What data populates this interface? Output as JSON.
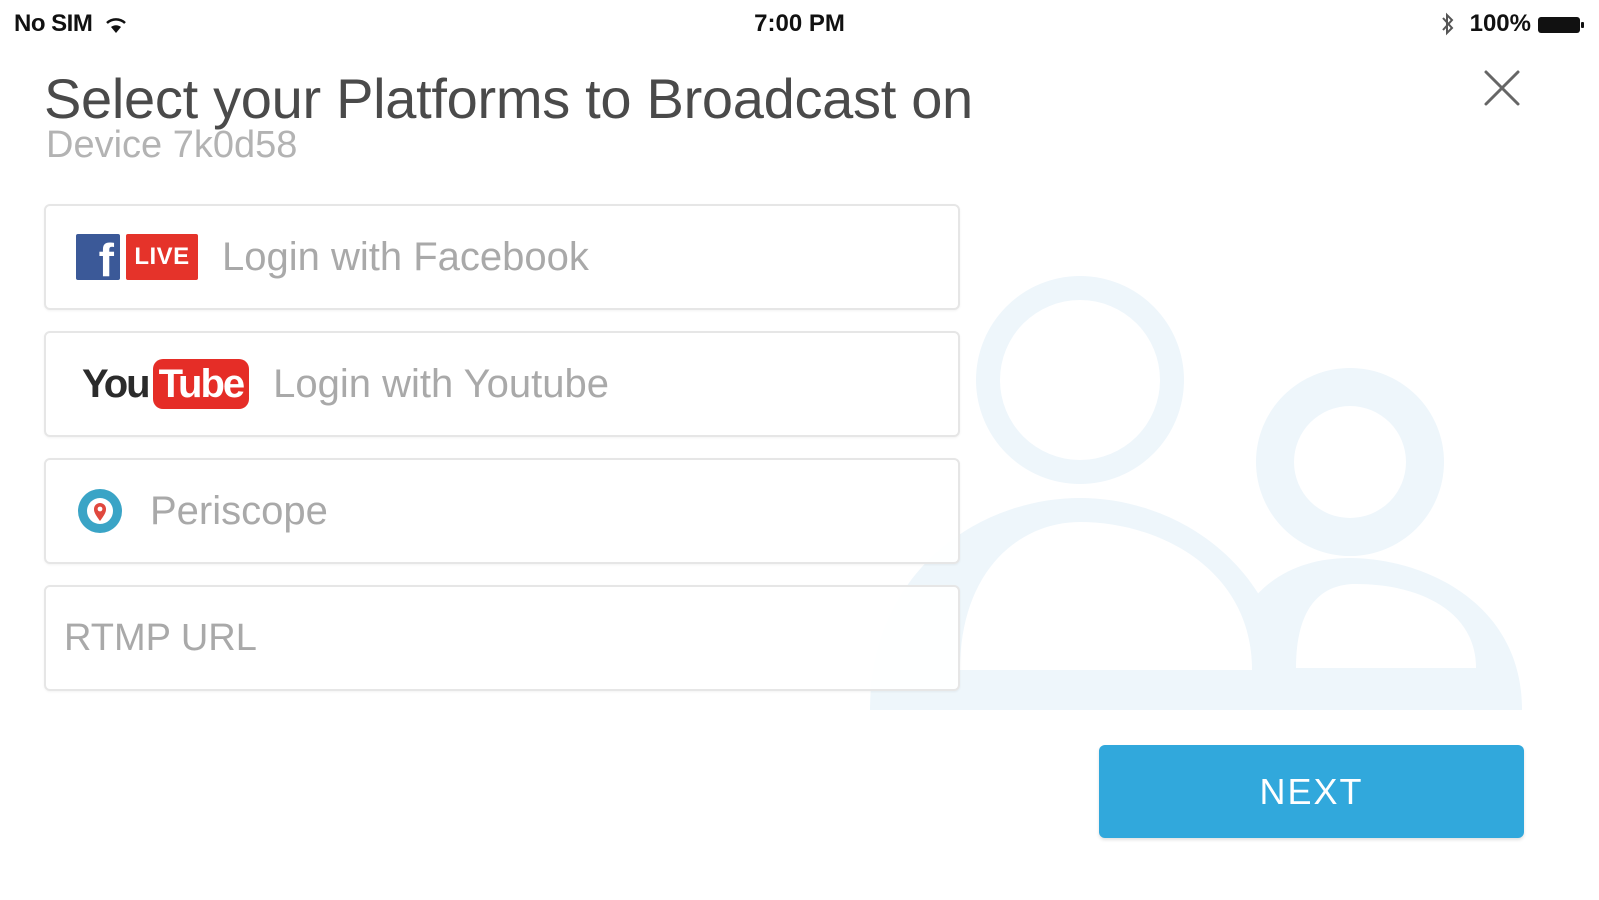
{
  "status_bar": {
    "carrier": "No SIM",
    "time": "7:00 PM",
    "battery": "100%",
    "icons": [
      "wifi-icon",
      "bluetooth-icon",
      "battery-icon"
    ]
  },
  "header": {
    "title": "Select your Platforms to Broadcast on",
    "subtitle": "Device 7k0d58",
    "close_icon": "close-icon"
  },
  "platforms": {
    "facebook": {
      "badge": "LIVE",
      "logo_letter": "f",
      "label": "Login with Facebook"
    },
    "youtube": {
      "logo_you": "You",
      "logo_tube": "Tube",
      "label": "Login with Youtube"
    },
    "periscope": {
      "label": "Periscope"
    },
    "rtmp": {
      "placeholder": "RTMP URL",
      "value": ""
    }
  },
  "footer": {
    "next_label": "NEXT"
  },
  "colors": {
    "accent": "#31a8dc",
    "facebook_blue": "#3b5998",
    "facebook_live_red": "#e5332a",
    "youtube_red": "#e52d27",
    "periscope_teal": "#3aa4c6",
    "illustration": "#eef6fb"
  }
}
